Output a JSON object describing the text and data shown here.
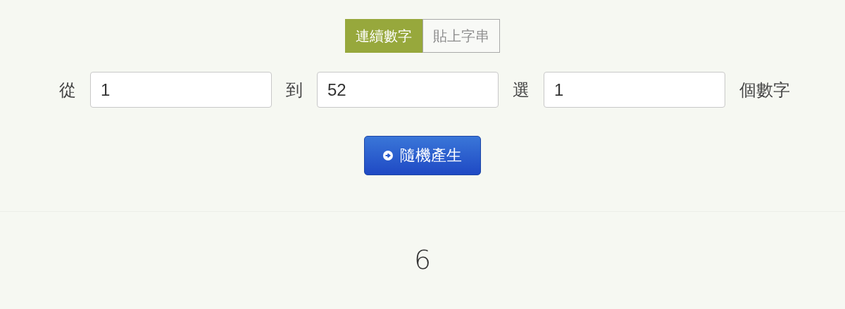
{
  "tabs": [
    {
      "label": "連續數字",
      "selected": true
    },
    {
      "label": "貼上字串",
      "selected": false
    }
  ],
  "form": {
    "from_label": "從",
    "from_value": "1",
    "to_label": "到",
    "to_value": "52",
    "pick_label": "選",
    "pick_value": "1",
    "suffix": "個數字"
  },
  "generate_button": {
    "label": "隨機產生"
  },
  "result": "6"
}
